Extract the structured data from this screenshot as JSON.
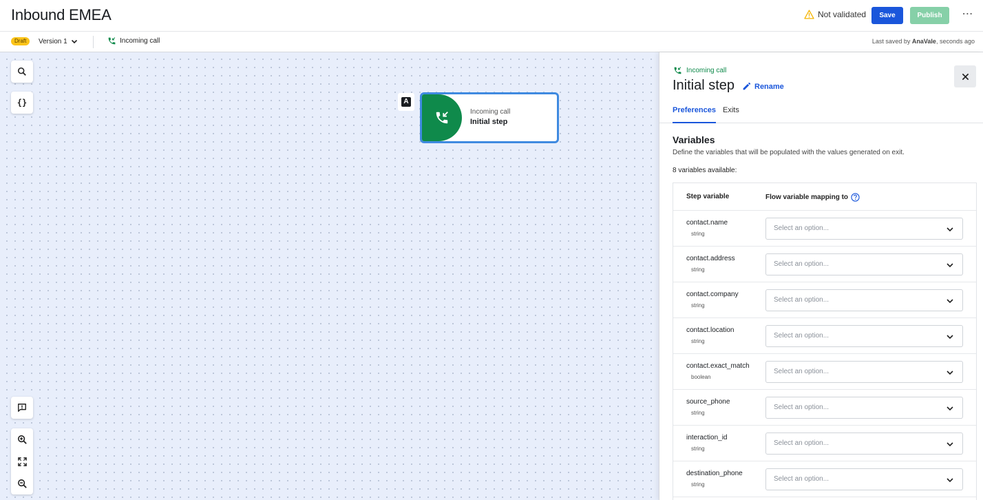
{
  "header": {
    "title": "Inbound EMEA",
    "status": "Not validated",
    "save_label": "Save",
    "publish_label": "Publish",
    "more_icon": "more-horizontal-icon"
  },
  "subbar": {
    "draft_badge": "Draft",
    "version": "Version 1",
    "trigger": "Incoming call",
    "last_saved_prefix": "Last saved by",
    "last_saved_user": "AnaVale",
    "last_saved_suffix": ", seconds ago"
  },
  "canvas": {
    "tools": [
      "search-icon",
      "braces-icon",
      "feedback-icon",
      "zoom-in-icon",
      "fit-view-icon",
      "zoom-out-icon"
    ],
    "label_badge": "A",
    "node": {
      "subtitle": "Incoming call",
      "title": "Initial step"
    }
  },
  "panel": {
    "trigger": "Incoming call",
    "title": "Initial step",
    "rename_label": "Rename",
    "tabs": [
      {
        "label": "Preferences",
        "active": true
      },
      {
        "label": "Exits",
        "active": false
      }
    ],
    "section_title": "Variables",
    "section_desc": "Define the variables that will be populated with the values generated on exit.",
    "available": "8 variables available:",
    "col_step": "Step variable",
    "col_flow": "Flow variable mapping to",
    "variables": [
      {
        "name": "contact.name",
        "type": "string",
        "placeholder": "Select an option..."
      },
      {
        "name": "contact.address",
        "type": "string",
        "placeholder": "Select an option..."
      },
      {
        "name": "contact.company",
        "type": "string",
        "placeholder": "Select an option..."
      },
      {
        "name": "contact.location",
        "type": "string",
        "placeholder": "Select an option..."
      },
      {
        "name": "contact.exact_match",
        "type": "boolean",
        "placeholder": "Select an option..."
      },
      {
        "name": "source_phone",
        "type": "string",
        "placeholder": "Select an option..."
      },
      {
        "name": "interaction_id",
        "type": "string",
        "placeholder": "Select an option..."
      },
      {
        "name": "destination_phone",
        "type": "string",
        "placeholder": "Select an option..."
      }
    ]
  },
  "colors": {
    "primary": "#1a56db",
    "publish_disabled": "#86d0a8",
    "node_green": "#0f8a4b",
    "draft_yellow": "#fcc419",
    "canvas_bg": "#e8eefb",
    "warning": "#f5b400"
  }
}
